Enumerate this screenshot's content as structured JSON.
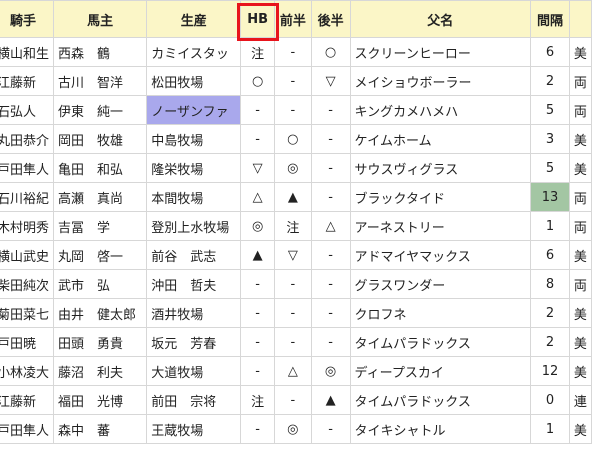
{
  "headers": {
    "jockey": "騎手",
    "owner": "馬主",
    "breeder": "生産",
    "hb": "HB",
    "first_half": "前半",
    "second_half": "後半",
    "sire": "父名",
    "interval": "間隔",
    "extra": ""
  },
  "rows": [
    {
      "jockey": "横山和生",
      "owner": "西森　鶴",
      "breeder": "カミイスタッ",
      "hb": "注",
      "first_half": "-",
      "second_half": "○",
      "sire": "スクリーンヒーロー",
      "interval": "6",
      "extra": "美"
    },
    {
      "jockey": "江藤新",
      "owner": "古川　智洋",
      "breeder": "松田牧場",
      "hb": "○",
      "first_half": "-",
      "second_half": "▽",
      "sire": "メイショウボーラー",
      "interval": "2",
      "extra": "両"
    },
    {
      "jockey": "石弘人",
      "owner": "伊東　純一",
      "breeder": "ノーザンファ",
      "hb": "-",
      "first_half": "-",
      "second_half": "-",
      "sire": "キングカメハメハ",
      "interval": "5",
      "extra": "両"
    },
    {
      "jockey": "丸田恭介",
      "owner": "岡田　牧雄",
      "breeder": "中島牧場",
      "hb": "-",
      "first_half": "○",
      "second_half": "-",
      "sire": "ケイムホーム",
      "interval": "3",
      "extra": "美"
    },
    {
      "jockey": "戸田隼人",
      "owner": "亀田　和弘",
      "breeder": "隆栄牧場",
      "hb": "▽",
      "first_half": "◎",
      "second_half": "-",
      "sire": "サウスヴィグラス",
      "interval": "5",
      "extra": "美"
    },
    {
      "jockey": "石川裕紀",
      "owner": "高瀬　真尚",
      "breeder": "本間牧場",
      "hb": "△",
      "first_half": "▲",
      "second_half": "-",
      "sire": "ブラックタイド",
      "interval": "13",
      "extra": "両"
    },
    {
      "jockey": "木村明秀",
      "owner": "吉冨　学",
      "breeder": "登別上水牧場",
      "hb": "◎",
      "first_half": "注",
      "second_half": "△",
      "sire": "アーネストリー",
      "interval": "1",
      "extra": "両"
    },
    {
      "jockey": "横山武史",
      "owner": "丸岡　啓一",
      "breeder": "前谷　武志",
      "hb": "▲",
      "first_half": "▽",
      "second_half": "-",
      "sire": "アドマイヤマックス",
      "interval": "6",
      "extra": "美"
    },
    {
      "jockey": "柴田純次",
      "owner": "武市　弘",
      "breeder": "沖田　哲夫",
      "hb": "-",
      "first_half": "-",
      "second_half": "-",
      "sire": "グラスワンダー",
      "interval": "8",
      "extra": "両"
    },
    {
      "jockey": "菊田菜七",
      "owner": "由井　健太郎",
      "breeder": "酒井牧場",
      "hb": "-",
      "first_half": "-",
      "second_half": "-",
      "sire": "クロフネ",
      "interval": "2",
      "extra": "美"
    },
    {
      "jockey": "戸田暁",
      "owner": "田頭　勇貴",
      "breeder": "坂元　芳春",
      "hb": "-",
      "first_half": "-",
      "second_half": "-",
      "sire": "タイムパラドックス",
      "interval": "2",
      "extra": "美"
    },
    {
      "jockey": "小林凌大",
      "owner": "藤沼　利夫",
      "breeder": "大道牧場",
      "hb": "-",
      "first_half": "△",
      "second_half": "◎",
      "sire": "ディープスカイ",
      "interval": "12",
      "extra": "美"
    },
    {
      "jockey": "江藤新",
      "owner": "福田　光博",
      "breeder": "前田　宗将",
      "hb": "注",
      "first_half": "-",
      "second_half": "▲",
      "sire": "タイムパラドックス",
      "interval": "0",
      "extra": "連"
    },
    {
      "jockey": "戸田隼人",
      "owner": "森中　蕃",
      "breeder": "王蔵牧場",
      "hb": "-",
      "first_half": "◎",
      "second_half": "-",
      "sire": "タイキシャトル",
      "interval": "1",
      "extra": "美"
    }
  ],
  "colors": {
    "header_bg": "#fbf6c7",
    "highlight_breeder": "#a9a8ec",
    "highlight_interval": "#a3c6a3",
    "annotation_box": "#e8141c"
  }
}
